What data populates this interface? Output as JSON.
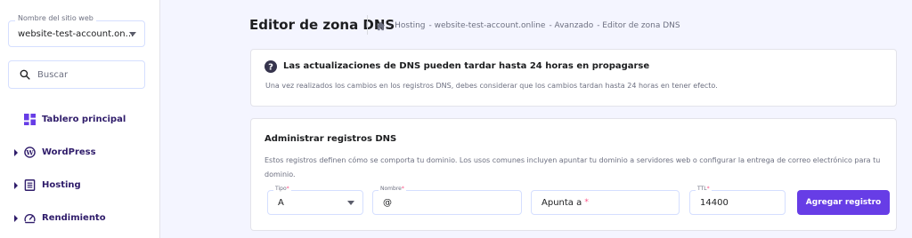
{
  "sidebar": {
    "site_select": {
      "label": "Nombre del sitio web",
      "value": "website-test-account.on..."
    },
    "search": {
      "placeholder": "Buscar"
    },
    "items": [
      {
        "label": "Tablero principal",
        "icon": "dashboard-icon",
        "expandable": false
      },
      {
        "label": "WordPress",
        "icon": "wordpress-icon",
        "expandable": true
      },
      {
        "label": "Hosting",
        "icon": "hosting-icon",
        "expandable": true
      },
      {
        "label": "Rendimiento",
        "icon": "performance-icon",
        "expandable": true
      }
    ]
  },
  "header": {
    "title": "Editor de zona DNS",
    "breadcrumb": [
      "- Hosting",
      "- website-test-account.online",
      "- Avanzado",
      "- Editor de zona DNS"
    ]
  },
  "info_card": {
    "title": "Las actualizaciones de DNS pueden tardar hasta 24 horas en propagarse",
    "text": "Una vez realizados los cambios en los registros DNS, debes considerar que los cambios tardan hasta 24 horas en tener efecto."
  },
  "dns_card": {
    "title": "Administrar registros DNS",
    "description": "Estos registros definen cómo se comporta tu dominio. Los usos comunes incluyen apuntar tu dominio a servidores web o configurar la entrega de correo electrónico para tu dominio.",
    "form": {
      "type": {
        "label": "Tipo",
        "value": "A"
      },
      "name": {
        "label": "Nombre",
        "value": "@"
      },
      "points_to": {
        "placeholder": "Apunta a"
      },
      "ttl": {
        "label": "TTL",
        "value": "14400"
      },
      "submit_label": "Agregar registro"
    }
  },
  "colors": {
    "accent": "#673de6",
    "text_primary": "#2f1c6a",
    "required": "#fc5185",
    "background": "#f4f5ff"
  }
}
